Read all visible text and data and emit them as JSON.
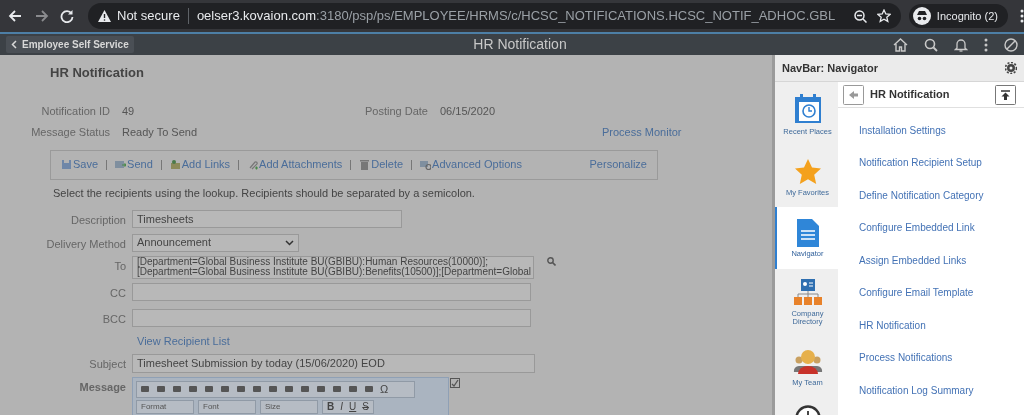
{
  "browser": {
    "not_secure": "Not secure",
    "url_host": "oelser3.kovaion.com",
    "url_rest": ":3180/psp/ps/EMPLOYEE/HRMS/c/HCSC_NOTIFICATIONS.HCSC_NOTIF_ADHOC.GBL",
    "profile": "Incognito (2)"
  },
  "header": {
    "back": "Employee Self Service",
    "title": "HR Notification"
  },
  "page": {
    "title": "HR Notification",
    "info": [
      {
        "label": "Notification ID",
        "value": "49"
      },
      {
        "label": "Message Status",
        "value": "Ready To Send"
      }
    ],
    "posting": {
      "label": "Posting Date",
      "value": "06/15/2020"
    },
    "process_monitor": "Process Monitor",
    "toolbar": [
      {
        "kind": "save",
        "label": "Save"
      },
      {
        "kind": "send",
        "label": "Send"
      },
      {
        "kind": "links",
        "label": "Add Links"
      },
      {
        "kind": "attach",
        "label": "Add Attachments"
      },
      {
        "kind": "delete",
        "label": "Delete"
      },
      {
        "kind": "options",
        "label": "Advanced Options"
      }
    ],
    "personalize": "Personalize",
    "instruction": "Select the recipients using the lookup. Recipients should be separated by a semicolon.",
    "description": {
      "label": "Description",
      "value": "Timesheets"
    },
    "delivery": {
      "label": "Delivery Method",
      "value": "Announcement"
    },
    "to": {
      "label": "To",
      "lines": [
        "[Department=Global Business Institute BU(GBIBU):Human Resources(10000)];",
        "[Department=Global Business Institute BU(GBIBU):Benefits(10500)];[Department=Global"
      ]
    },
    "cc": {
      "label": "CC"
    },
    "bcc": {
      "label": "BCC"
    },
    "view_list": "View Recipient List",
    "subject": {
      "label": "Subject",
      "value": "Timesheet Submission by today (15/06/2020) EOD"
    },
    "message": {
      "label": "Message",
      "special_char": "Ω",
      "dropdowns": [
        "Format",
        "Font",
        "Size"
      ],
      "styles": [
        "B",
        "I",
        "U",
        "S"
      ]
    }
  },
  "navbar": {
    "title": "NavBar: Navigator",
    "tiles": [
      {
        "kind": "recent",
        "label": "Recent Places",
        "selected": false
      },
      {
        "kind": "favorites",
        "label": "My Favorites",
        "selected": false
      },
      {
        "kind": "navigator",
        "label": "Navigator",
        "selected": true
      },
      {
        "kind": "directory",
        "label": "Company Directory",
        "selected": false
      },
      {
        "kind": "team",
        "label": "My Team",
        "selected": false
      },
      {
        "kind": "clock",
        "selected": false
      }
    ],
    "folder": "HR Notification",
    "items": [
      "Installation Settings",
      "Notification Recipient Setup",
      "Define Notification Category",
      "Configure Embedded Link",
      "Assign Embedded Links",
      "Configure Email Template",
      "HR Notification",
      "Process Notifications",
      "Notification Log Summary"
    ]
  }
}
